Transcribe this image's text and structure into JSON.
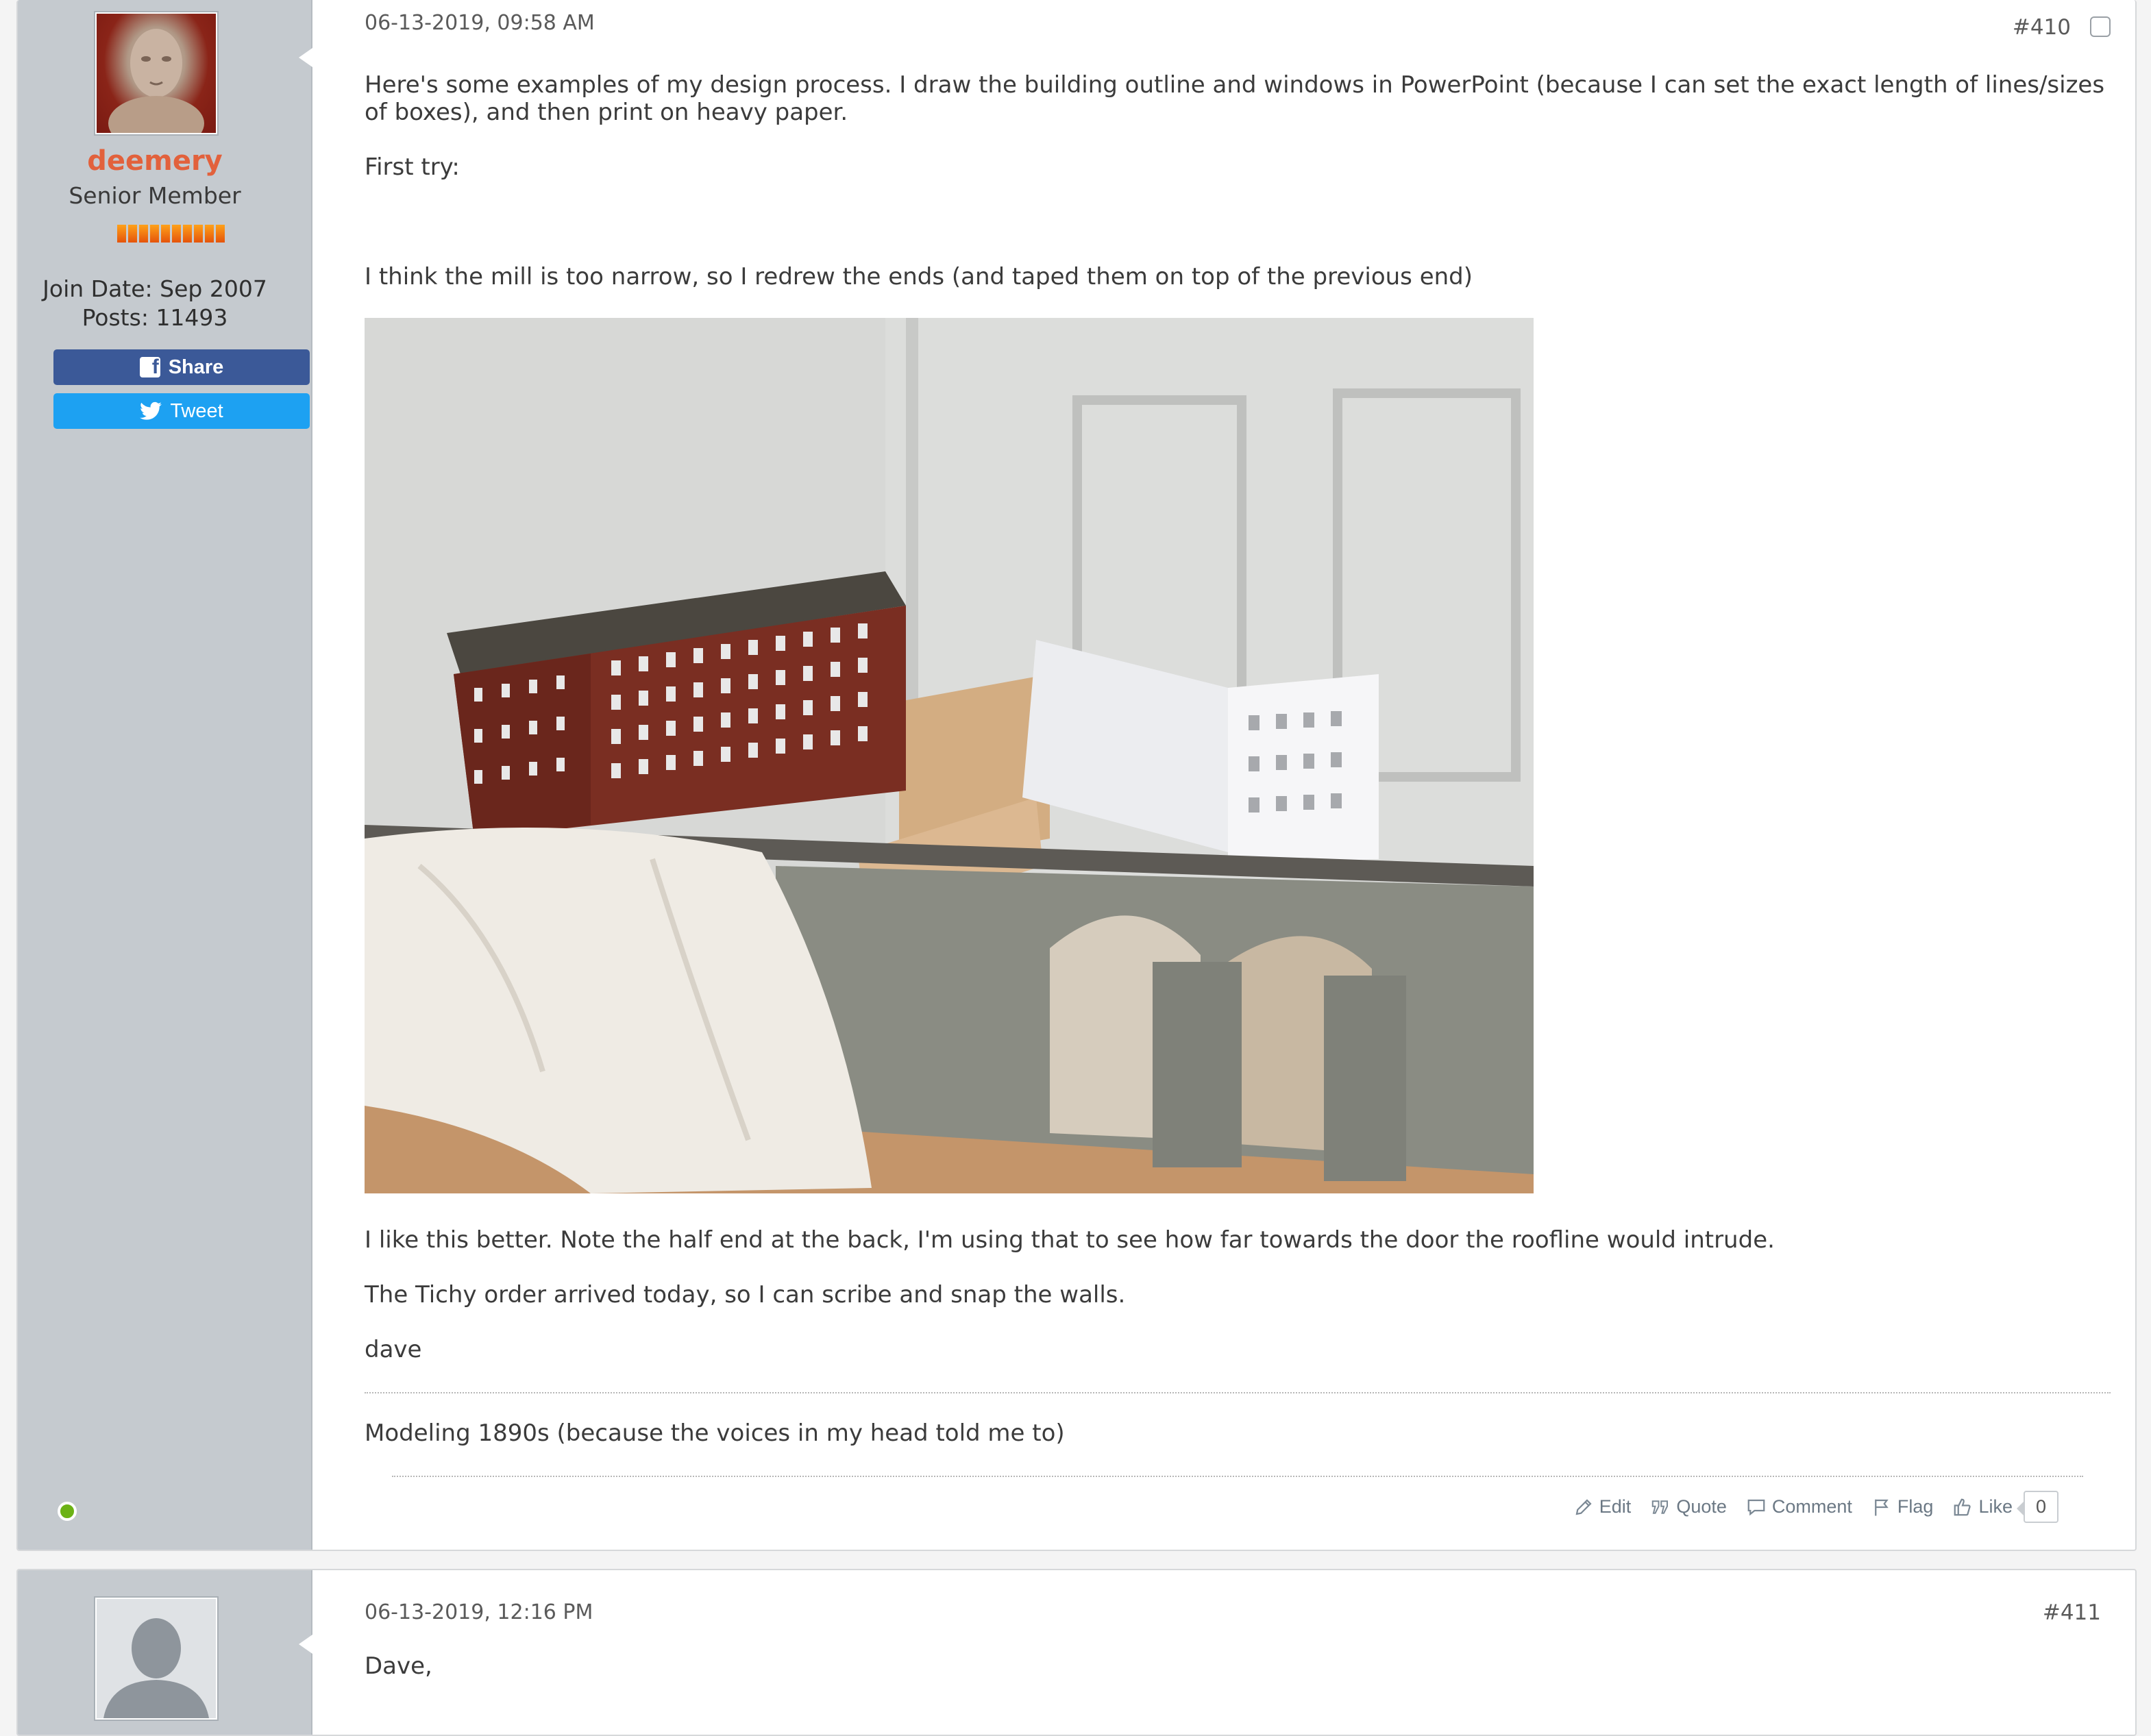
{
  "post1": {
    "username": "deemery",
    "usertitle": "Senior Member",
    "join_label": "Join Date:",
    "join_value": "Sep 2007",
    "posts_label": "Posts:",
    "posts_value": "11493",
    "share_label": "Share",
    "tweet_label": "Tweet",
    "date": "06-13-2019, 09:58 AM",
    "number": "#410",
    "paragraphs": [
      "Here's some examples of my design process. I draw the building outline and windows in PowerPoint (because I can set the exact length of lines/sizes of boxes), and then print on heavy paper.",
      "First try:",
      "I think the mill is too narrow, so I redrew the ends (and taped them on top of the previous end)",
      "I like this better. Note the half end at the back, I'm using that to see how far towards the door the roofline would intrude.",
      "The Tichy order arrived today, so I can scribe and snap the walls.",
      "dave"
    ],
    "signature": "Modeling 1890s (because the voices in my head told me to)",
    "controls": {
      "edit": "Edit",
      "quote": "Quote",
      "comment": "Comment",
      "flag": "Flag",
      "like": "Like",
      "like_count": "0"
    }
  },
  "post2": {
    "date": "06-13-2019, 12:16 PM",
    "number": "#411",
    "first_line": "Dave,"
  },
  "colors": {
    "username": "#e2613c",
    "sidebar": "#c5cacf",
    "share": "#3b5998",
    "tweet": "#1da1f2",
    "online": "#6bb215"
  },
  "icons": [
    "pencil-icon",
    "quote-icon",
    "comment-icon",
    "flag-icon",
    "thumbs-up-icon",
    "facebook-icon",
    "twitter-icon"
  ]
}
